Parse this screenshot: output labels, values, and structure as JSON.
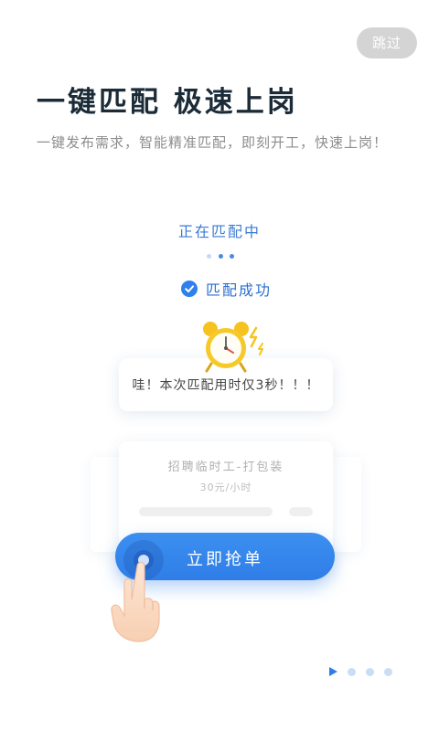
{
  "header": {
    "skip_label": "跳过",
    "title": "一键匹配  极速上岗",
    "subtitle": "一键发布需求，智能精准匹配，即刻开工，快速上岗！"
  },
  "matching": {
    "status_label": "正在匹配中",
    "success_label": "匹配成功"
  },
  "bubble": {
    "message": "哇！本次匹配用时仅3秒！！！"
  },
  "job_card": {
    "title": "招聘临时工-打包装",
    "salary": "30元/小时"
  },
  "action": {
    "grab_label": "立即抢单"
  },
  "pager": {
    "total": 4,
    "current": 1
  },
  "colors": {
    "accent": "#2f7ee8",
    "title": "#1c2b38",
    "subtitle": "#8c8c8c",
    "skip_bg": "#d4d4d4",
    "clock_yellow": "#f7c928"
  },
  "icons": {
    "check": "check-circle-icon",
    "clock": "alarm-clock-icon",
    "hand": "pointing-hand-icon",
    "pager_current": "play-arrow-icon"
  }
}
